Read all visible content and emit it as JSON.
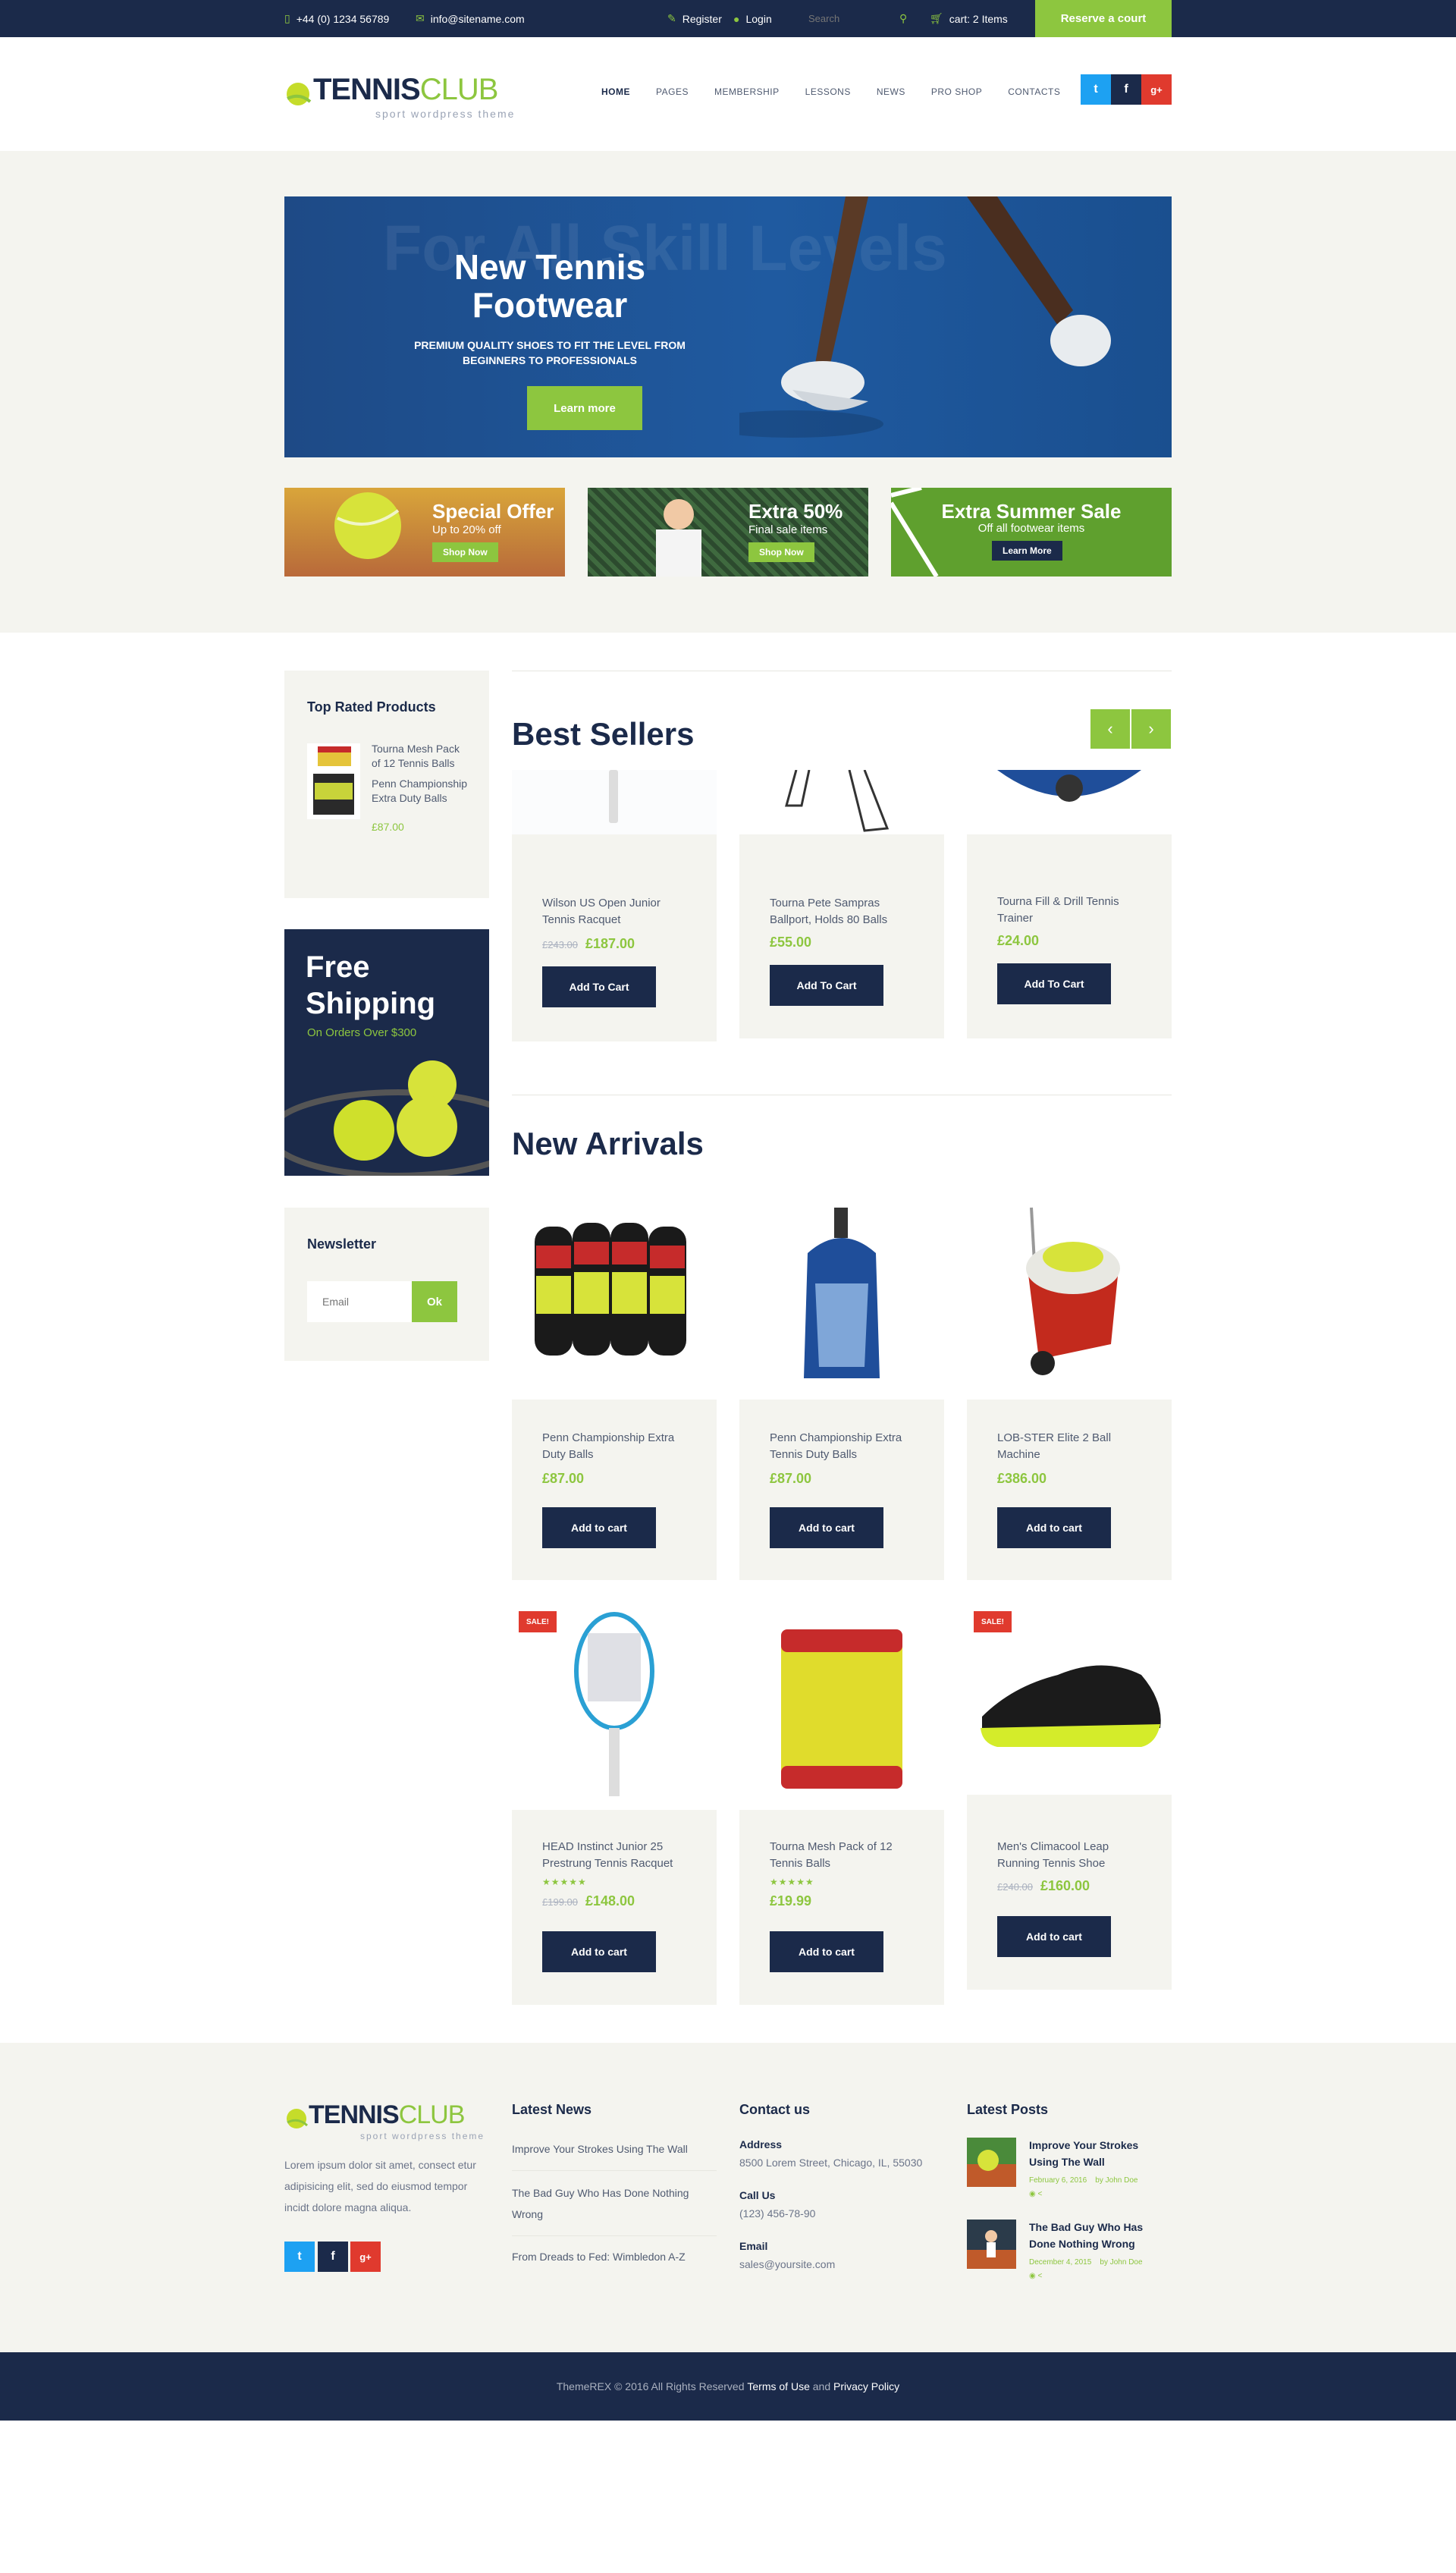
{
  "topbar": {
    "phone": "+44 (0) 1234 56789",
    "email": "info@sitename.com",
    "register": "Register",
    "login": "Login",
    "search_placeholder": "Search",
    "cart": "cart: 2 Items",
    "reserve": "Reserve a court"
  },
  "header": {
    "logo_main": "TENNIS",
    "logo_accent": "CLUB",
    "logo_sub": "sport wordpress theme",
    "nav": [
      "HOME",
      "PAGES",
      "MEMBERSHIP",
      "LESSONS",
      "NEWS",
      "PRO SHOP",
      "CONTACTS"
    ],
    "social": [
      "t",
      "f",
      "g+"
    ]
  },
  "colors": {
    "navy": "#1b2a4a",
    "green": "#8dc63f",
    "red": "#e03a2e",
    "twitter": "#1da1f2"
  },
  "hero": {
    "bg_text": "For All Skill Levels",
    "title_line1": "New Tennis",
    "title_line2": "Footwear",
    "subtitle_line1": "PREMIUM QUALITY SHOES TO FIT THE LEVEL FROM",
    "subtitle_line2": "BEGINNERS TO PROFESSIONALS",
    "button": "Learn more"
  },
  "promos": [
    {
      "title": "Special Offer",
      "sub": "Up to 20% off",
      "button": "Shop Now"
    },
    {
      "title": "Extra 50%",
      "sub": "Final sale items",
      "button": "Shop Now"
    },
    {
      "title": "Extra Summer Sale",
      "sub": "Off all footwear items",
      "button": "Learn More"
    }
  ],
  "sidebar": {
    "top_rated": {
      "title": "Top Rated Products",
      "items": [
        {
          "name": "Tourna Mesh Pack of 12 Tennis Balls"
        },
        {
          "name": "Penn Championship Extra Duty Balls",
          "price": "£87.00"
        }
      ]
    },
    "shipping": {
      "line1": "Free",
      "line2": "Shipping",
      "sub": "On Orders Over $300"
    },
    "newsletter": {
      "title": "Newsletter",
      "placeholder": "Email",
      "button": "Ok"
    }
  },
  "best_sellers": {
    "title": "Best Sellers",
    "prev": "‹",
    "next": "›",
    "products": [
      {
        "name": "Wilson US Open Junior Tennis Racquet",
        "old_price": "£243.00",
        "price": "£187.00",
        "button": "Add To Cart"
      },
      {
        "name": "Tourna Pete Sampras Ballport, Holds 80 Balls",
        "price": "£55.00",
        "button": "Add To Cart"
      },
      {
        "name": "Tourna Fill & Drill Tennis Trainer",
        "price": "£24.00",
        "button": "Add To Cart"
      }
    ]
  },
  "new_arrivals": {
    "title": "New Arrivals",
    "products": [
      {
        "name": "Penn Championship Extra Duty Balls",
        "price": "£87.00",
        "button": "Add to cart"
      },
      {
        "name": "Penn Championship Extra Tennis Duty Balls",
        "price": "£87.00",
        "button": "Add to cart"
      },
      {
        "name": "LOB-STER Elite 2 Ball Machine",
        "price": "£386.00",
        "button": "Add to cart"
      },
      {
        "name": "HEAD Instinct Junior 25 Prestrung Tennis Racquet",
        "old_price": "£199.00",
        "price": "£148.00",
        "button": "Add to cart",
        "badge": "SALE!",
        "rating": 5
      },
      {
        "name": "Tourna Mesh Pack of 12 Tennis Balls",
        "price": "£19.99",
        "button": "Add to cart",
        "rating": 5
      },
      {
        "name": "Men's Climacool Leap Running Tennis Shoe",
        "old_price": "£240.00",
        "price": "£160.00",
        "button": "Add to cart",
        "badge": "SALE!"
      }
    ]
  },
  "footer": {
    "about": "Lorem ipsum dolor sit amet, consect etur adipisicing elit, sed do eiusmod tempor incidt dolore magna aliqua.",
    "latest_news": {
      "title": "Latest News",
      "items": [
        "Improve Your Strokes Using The Wall",
        "The Bad Guy Who Has Done Nothing Wrong",
        "From Dreads to Fed: Wimbledon A-Z"
      ]
    },
    "contact": {
      "title": "Contact us",
      "address_label": "Address",
      "address": "8500 Lorem Street, Chicago, IL, 55030",
      "call_label": "Call Us",
      "phone": "(123) 456-78-90",
      "email_label": "Email",
      "email": "sales@yoursite.com"
    },
    "latest_posts": {
      "title": "Latest Posts",
      "posts": [
        {
          "title": "Improve Your Strokes Using The Wall",
          "date": "February 6, 2016",
          "author": "by John Doe"
        },
        {
          "title": "The Bad Guy Who Has Done Nothing Wrong",
          "date": "December 4, 2015",
          "author": "by John Doe"
        }
      ]
    },
    "copyright": "ThemeREX © 2016 All Rights Reserved",
    "terms": "Terms of Use",
    "and": "and",
    "privacy": "Privacy Policy"
  }
}
